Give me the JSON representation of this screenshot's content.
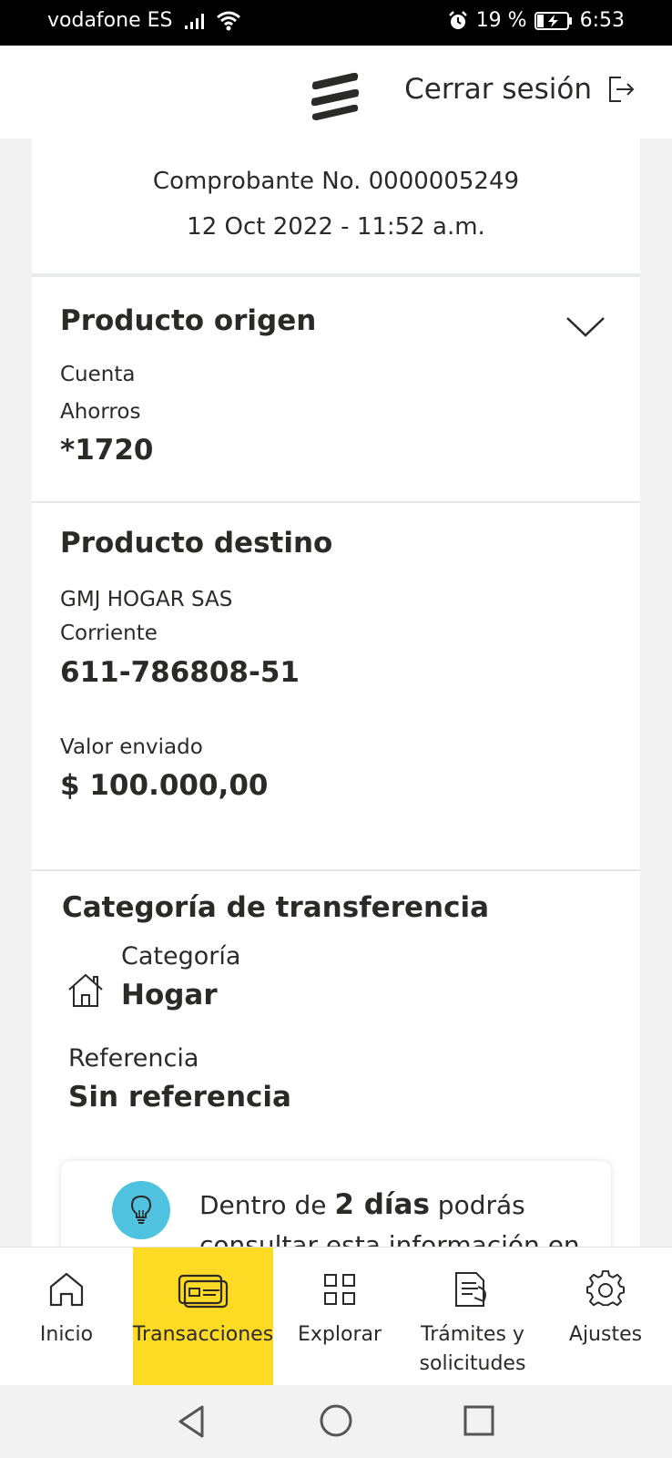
{
  "status_bar": {
    "carrier": "vodafone ES",
    "battery": "19 %",
    "time": "6:53"
  },
  "header": {
    "logout_label": "Cerrar sesión"
  },
  "receipt": {
    "number": "Comprobante No. 0000005249",
    "datetime": "12 Oct 2022 - 11:52 a.m."
  },
  "origin": {
    "title": "Producto origen",
    "type_line1": "Cuenta",
    "type_line2": "Ahorros",
    "account": "*1720"
  },
  "destination": {
    "title": "Producto destino",
    "name": "GMJ HOGAR SAS",
    "type": "Corriente",
    "account": "611-786808-51",
    "amount_label": "Valor enviado",
    "amount": "$ 100.000,00"
  },
  "category": {
    "title": "Categoría de transferencia",
    "category_label": "Categoría",
    "category_value": "Hogar",
    "reference_label": "Referencia",
    "reference_value": "Sin referencia"
  },
  "tip": {
    "prefix": "Dentro de ",
    "highlight": "2 días",
    "suffix": " podrás",
    "line2": "consultar esta información en"
  },
  "bottom_nav": {
    "items": [
      {
        "label": "Inicio",
        "icon": "home-icon"
      },
      {
        "label": "Transacciones",
        "icon": "card-icon",
        "active": true
      },
      {
        "label": "Explorar",
        "icon": "grid-icon"
      },
      {
        "label_line1": "Trámites y",
        "label_line2": "solicitudes",
        "icon": "document-icon"
      },
      {
        "label": "Ajustes",
        "icon": "gear-icon"
      }
    ]
  },
  "colors": {
    "accent": "#fdda24",
    "tip_icon_bg": "#4fc2e0",
    "text": "#2c2a29"
  }
}
